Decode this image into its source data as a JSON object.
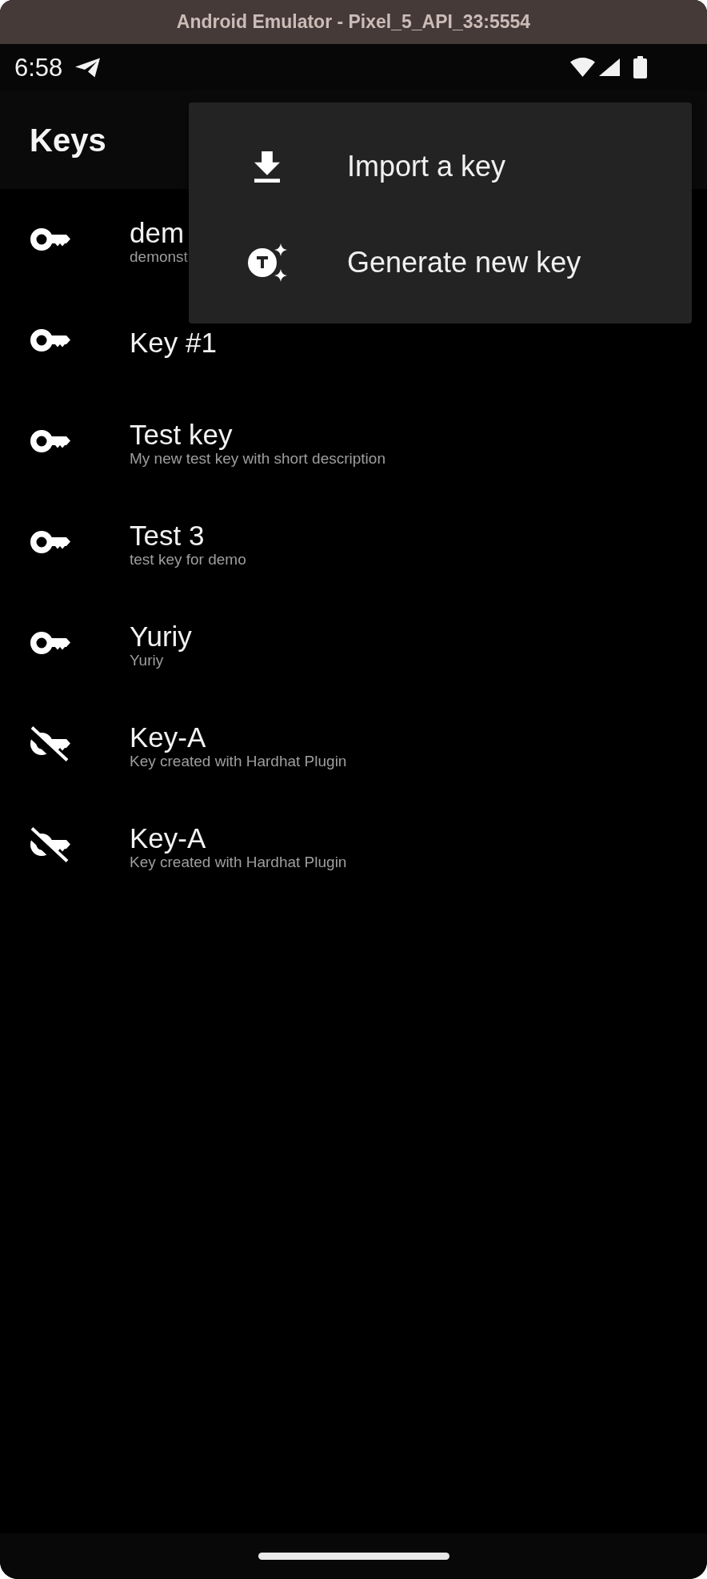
{
  "window": {
    "title": "Android Emulator - Pixel_5_API_33:5554"
  },
  "status_bar": {
    "time": "6:58"
  },
  "app_bar": {
    "title": "Keys"
  },
  "keys": [
    {
      "kind": "key",
      "name": "dem",
      "description": "demonst"
    },
    {
      "kind": "key",
      "name": "Key #1"
    },
    {
      "kind": "key",
      "name": "Test key",
      "description": "My new test key with short description"
    },
    {
      "kind": "key",
      "name": "Test 3",
      "description": "test key for demo"
    },
    {
      "kind": "key",
      "name": "Yuriy",
      "description": "Yuriy"
    },
    {
      "kind": "key_off",
      "name": "Key-A",
      "description": "Key created with Hardhat Plugin"
    },
    {
      "kind": "key_off",
      "name": "Key-A",
      "description": "Key created with Hardhat Plugin"
    }
  ],
  "menu": {
    "items": [
      {
        "kind": "import",
        "label": "Import a key"
      },
      {
        "kind": "generate",
        "label": "Generate new key"
      }
    ]
  }
}
